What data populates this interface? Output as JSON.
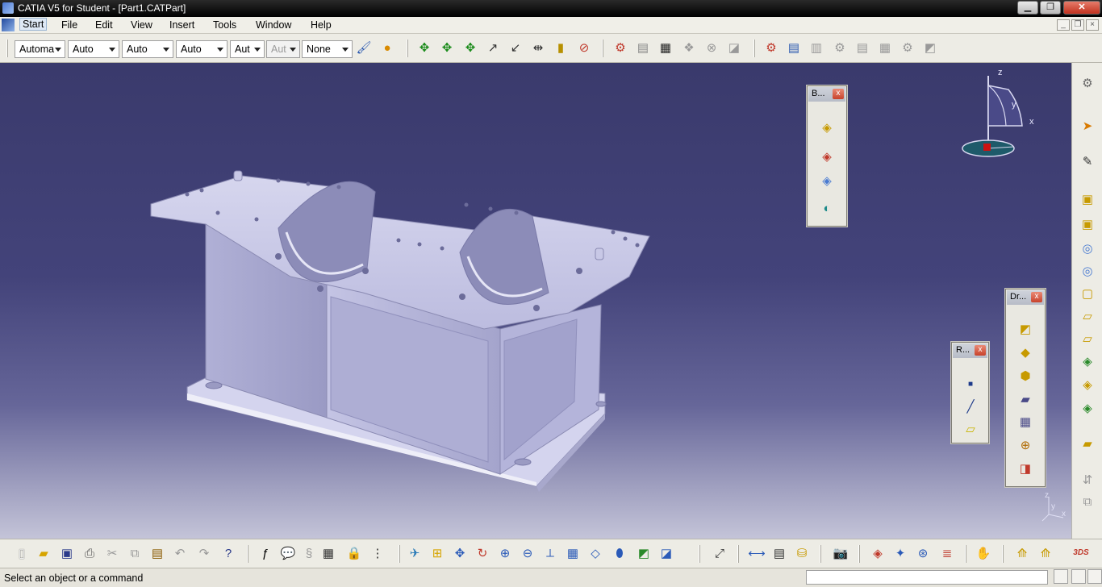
{
  "window": {
    "title": "CATIA V5 for Student - [Part1.CATPart]",
    "minimize": "▁",
    "maximize": "❐",
    "close": "✕"
  },
  "menu": [
    "Start",
    "File",
    "Edit",
    "View",
    "Insert",
    "Tools",
    "Window",
    "Help"
  ],
  "mdi_controls": {
    "minimize": "_",
    "restore": "❐",
    "close": "×"
  },
  "toolbar": {
    "dropdowns": [
      "Automa",
      "Auto",
      "Auto",
      "Auto",
      "Aut",
      "Aut",
      "None"
    ],
    "icons": [
      "paint-brush-icon",
      "object-properties-icon",
      "compass-move-icon",
      "snap-icon",
      "snap-clear-icon",
      "line-icon",
      "curve-icon",
      "dimension-icon",
      "measure-icon",
      "pick-icon",
      "workbench-icon",
      "export-icon",
      "grid-icon",
      "pattern-icon",
      "constraint-icon",
      "solid-icon",
      "apply-icon",
      "settings-icon",
      "refresh-icon",
      "gear-icon",
      "library-icon"
    ]
  },
  "status": {
    "message": "Select an object or a command",
    "command_value": ""
  },
  "palettes": {
    "boolean": {
      "title": "B...",
      "close": "x"
    },
    "reference": {
      "title": "R...",
      "close": "x"
    },
    "dress_up": {
      "title": "Dr...",
      "close": "x"
    }
  },
  "compass": {
    "x": "x",
    "y": "y",
    "z": "z"
  },
  "corner_axes": {
    "x": "x",
    "y": "y",
    "z": "z"
  },
  "colors": {
    "viewport_top": "#3a3a6c",
    "viewport_bottom": "#c4c4d8",
    "part": "#c8c8e6",
    "titlebar": "#000000"
  }
}
